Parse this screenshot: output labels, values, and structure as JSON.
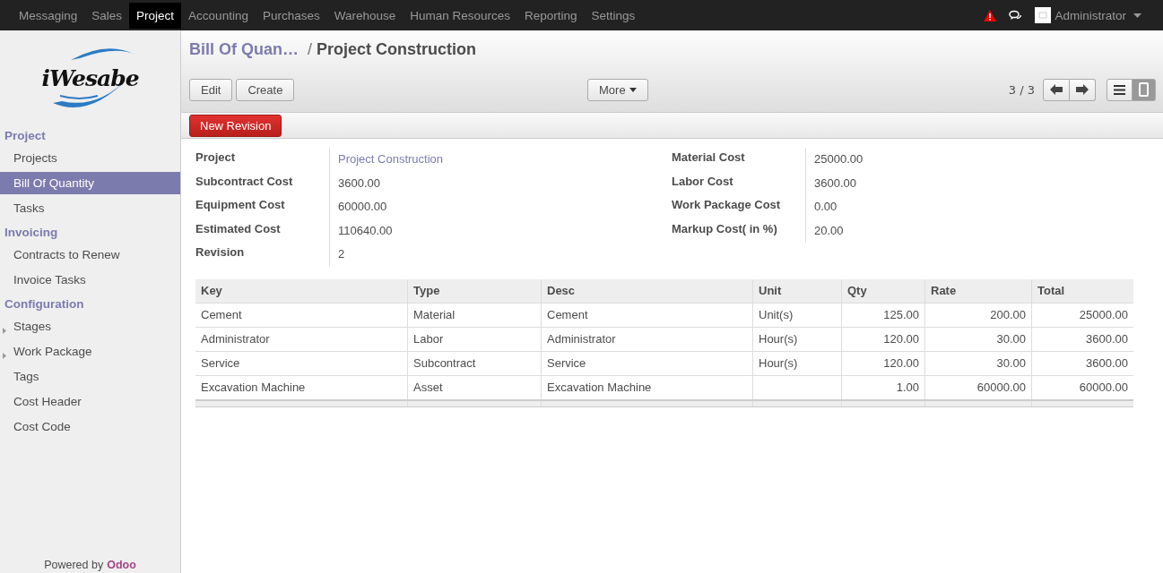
{
  "top_menu": {
    "items": [
      {
        "label": "Messaging",
        "selected": false
      },
      {
        "label": "Sales",
        "selected": false
      },
      {
        "label": "Project",
        "selected": true
      },
      {
        "label": "Accounting",
        "selected": false
      },
      {
        "label": "Purchases",
        "selected": false
      },
      {
        "label": "Warehouse",
        "selected": false
      },
      {
        "label": "Human Resources",
        "selected": false
      },
      {
        "label": "Reporting",
        "selected": false
      },
      {
        "label": "Settings",
        "selected": false
      }
    ],
    "user": "Administrator"
  },
  "sidebar": {
    "logo": "iWesabe",
    "sections": [
      {
        "title": "Project",
        "items": [
          {
            "label": "Projects",
            "selected": false,
            "expandable": false
          },
          {
            "label": "Bill Of Quantity",
            "selected": true,
            "expandable": false
          },
          {
            "label": "Tasks",
            "selected": false,
            "expandable": false
          }
        ]
      },
      {
        "title": "Invoicing",
        "items": [
          {
            "label": "Contracts to Renew",
            "selected": false,
            "expandable": false
          },
          {
            "label": "Invoice Tasks",
            "selected": false,
            "expandable": false
          }
        ]
      },
      {
        "title": "Configuration",
        "items": [
          {
            "label": "Stages",
            "selected": false,
            "expandable": true
          },
          {
            "label": "Work Package",
            "selected": false,
            "expandable": true
          },
          {
            "label": "Tags",
            "selected": false,
            "expandable": false
          },
          {
            "label": "Cost Header",
            "selected": false,
            "expandable": false
          },
          {
            "label": "Cost Code",
            "selected": false,
            "expandable": false
          }
        ]
      }
    ],
    "footer": {
      "prefix": "Powered by",
      "brand": "Odoo"
    }
  },
  "breadcrumb": {
    "parent": "Bill Of Quan…",
    "separator": "/",
    "current": "Project Construction"
  },
  "buttons": [
    "Edit",
    "Create"
  ],
  "more_button": "More",
  "pager": "3 / 3",
  "views": [
    {
      "kind": "list",
      "selected": false
    },
    {
      "kind": "form",
      "selected": true
    }
  ],
  "status_button": "New Revision",
  "form": {
    "left": [
      {
        "label": "Project",
        "value": "Project Construction",
        "kind": "link"
      },
      {
        "label": "Subcontract Cost",
        "value": "3600.00",
        "kind": "text"
      },
      {
        "label": "Equipment Cost",
        "value": "60000.00",
        "kind": "text"
      },
      {
        "label": "Estimated Cost",
        "value": "110640.00",
        "kind": "text"
      },
      {
        "label": "Revision",
        "value": "2",
        "kind": "text"
      }
    ],
    "right": [
      {
        "label": "Material Cost",
        "value": "25000.00",
        "kind": "text"
      },
      {
        "label": "Labor Cost",
        "value": "3600.00",
        "kind": "text"
      },
      {
        "label": "Work Package Cost",
        "value": "0.00",
        "kind": "text"
      },
      {
        "label": "Markup Cost( in %)",
        "value": "20.00",
        "kind": "text"
      }
    ]
  },
  "table": {
    "columns": [
      {
        "label": "Key",
        "kind": "text"
      },
      {
        "label": "Type",
        "kind": "text"
      },
      {
        "label": "Desc",
        "kind": "text"
      },
      {
        "label": "Unit",
        "kind": "text"
      },
      {
        "label": "Qty",
        "kind": "number"
      },
      {
        "label": "Rate",
        "kind": "number"
      },
      {
        "label": "Total",
        "kind": "number"
      }
    ],
    "rows": [
      [
        "Cement",
        "Material",
        "Cement",
        "Unit(s)",
        "125.00",
        "200.00",
        "25000.00"
      ],
      [
        "Administrator",
        "Labor",
        "Administrator",
        "Hour(s)",
        "120.00",
        "30.00",
        "3600.00"
      ],
      [
        "Service",
        "Subcontract",
        "Service",
        "Hour(s)",
        "120.00",
        "30.00",
        "3600.00"
      ],
      [
        "Excavation Machine",
        "Asset",
        "Excavation Machine",
        "",
        "1.00",
        "60000.00",
        "60000.00"
      ]
    ]
  }
}
